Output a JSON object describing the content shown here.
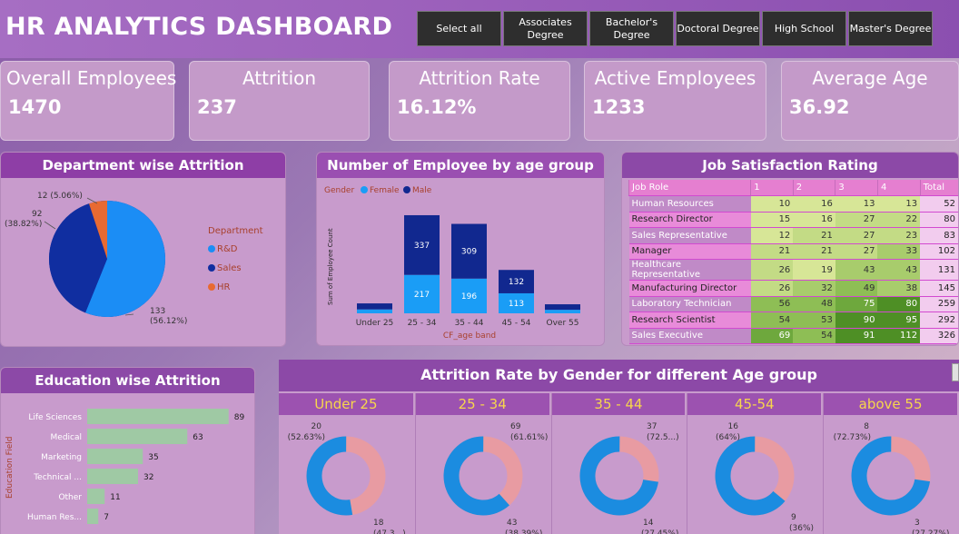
{
  "header": {
    "title": "HR ANALYTICS DASHBOARD",
    "slicers": [
      "Select all",
      "Associates Degree",
      "Bachelor's Degree",
      "Doctoral Degree",
      "High School",
      "Master's Degree"
    ]
  },
  "kpis": [
    {
      "label": "Overall Employees",
      "value": "1470"
    },
    {
      "label": "Attrition",
      "value": "237"
    },
    {
      "label": "Attrition Rate",
      "value": "16.12%"
    },
    {
      "label": "Active Employees",
      "value": "1233"
    },
    {
      "label": "Average Age",
      "value": "36.92"
    }
  ],
  "dept": {
    "title": "Department wise Attrition",
    "legend_title": "Department",
    "legend": [
      "R&D",
      "Sales",
      "HR"
    ],
    "colors": {
      "rd": "#1b8df5",
      "sales": "#102ea0",
      "hr": "#e86a32"
    },
    "labels": {
      "hr": "12 (5.06%)",
      "sales_n": "92",
      "sales_p": "(38.82%)",
      "rd_n": "133",
      "rd_p": "(56.12%)"
    }
  },
  "age": {
    "title": "Number of Employee by age group",
    "legend_title": "Gender",
    "legend": [
      "Female",
      "Male"
    ],
    "ylabel": "Sum of Employee Count",
    "xlabel": "CF_age band",
    "colors": {
      "female": "#1a9df6",
      "male": "#11288f"
    }
  },
  "jobsat": {
    "title": "Job Satisfaction Rating",
    "headers": [
      "Job Role",
      "1",
      "2",
      "3",
      "4",
      "Total"
    ],
    "rows": [
      [
        "Human Resources",
        "10",
        "16",
        "13",
        "13",
        "52"
      ],
      [
        "Research Director",
        "15",
        "16",
        "27",
        "22",
        "80"
      ],
      [
        "Sales Representative",
        "12",
        "21",
        "27",
        "23",
        "83"
      ],
      [
        "Manager",
        "21",
        "21",
        "27",
        "33",
        "102"
      ],
      [
        "Healthcare Representative",
        "26",
        "19",
        "43",
        "43",
        "131"
      ],
      [
        "Manufacturing Director",
        "26",
        "32",
        "49",
        "38",
        "145"
      ],
      [
        "Laboratory Technician",
        "56",
        "48",
        "75",
        "80",
        "259"
      ],
      [
        "Research Scientist",
        "54",
        "53",
        "90",
        "95",
        "292"
      ],
      [
        "Sales Executive",
        "69",
        "54",
        "91",
        "112",
        "326"
      ]
    ]
  },
  "edu": {
    "title": "Education wise Attrition",
    "ylabel": "Education Field",
    "bar_color": "#9fc9a4"
  },
  "gender": {
    "title": "Attrition Rate by Gender for different Age group",
    "groups": [
      {
        "name": "Under 25",
        "top": "20",
        "top_p": "(52.63%)",
        "bot": "18",
        "bot_p": "(47.3...)",
        "male": 52.63
      },
      {
        "name": "25 - 34",
        "top": "69",
        "top_p": "(61.61%)",
        "bot": "43",
        "bot_p": "(38.39%)",
        "male": 61.61
      },
      {
        "name": "35 - 44",
        "top": "37",
        "top_p": "(72.5...)",
        "bot": "14",
        "bot_p": "(27.45%)",
        "male": 72.55
      },
      {
        "name": "45-54",
        "top": "16",
        "top_p": "(64%)",
        "bot": "9",
        "bot_p": "(36%)",
        "male": 64
      },
      {
        "name": "above 55",
        "top": "8",
        "top_p": "(72.73%)",
        "bot": "3",
        "bot_p": "(27.27%)",
        "male": 72.73
      }
    ],
    "colors": {
      "male": "#1b8ce0",
      "female": "#e89ba2"
    }
  },
  "chart_data": [
    {
      "type": "pie",
      "title": "Department wise Attrition",
      "categories": [
        "R&D",
        "Sales",
        "HR"
      ],
      "values": [
        133,
        92,
        12
      ],
      "percent": [
        56.12,
        38.82,
        5.06
      ]
    },
    {
      "type": "bar",
      "title": "Number of Employee by age group",
      "categories": [
        "Under 25",
        "25 - 34",
        "35 - 44",
        "45 - 54",
        "Over 55"
      ],
      "series": [
        {
          "name": "Female",
          "values": [
            22,
            217,
            196,
            113,
            20
          ]
        },
        {
          "name": "Male",
          "values": [
            34,
            337,
            309,
            132,
            31
          ]
        }
      ],
      "xlabel": "CF_age band",
      "ylabel": "Sum of Employee Count",
      "data_labels": {
        "Female": [
          "",
          "217",
          "196",
          "113",
          ""
        ],
        "Male": [
          "",
          "337",
          "309",
          "132",
          ""
        ]
      }
    },
    {
      "type": "bar",
      "title": "Education wise Attrition",
      "categories": [
        "Life Sciences",
        "Medical",
        "Marketing",
        "Technical ...",
        "Other",
        "Human Res..."
      ],
      "values": [
        89,
        63,
        35,
        32,
        11,
        7
      ],
      "ylabel": "Education Field"
    }
  ]
}
